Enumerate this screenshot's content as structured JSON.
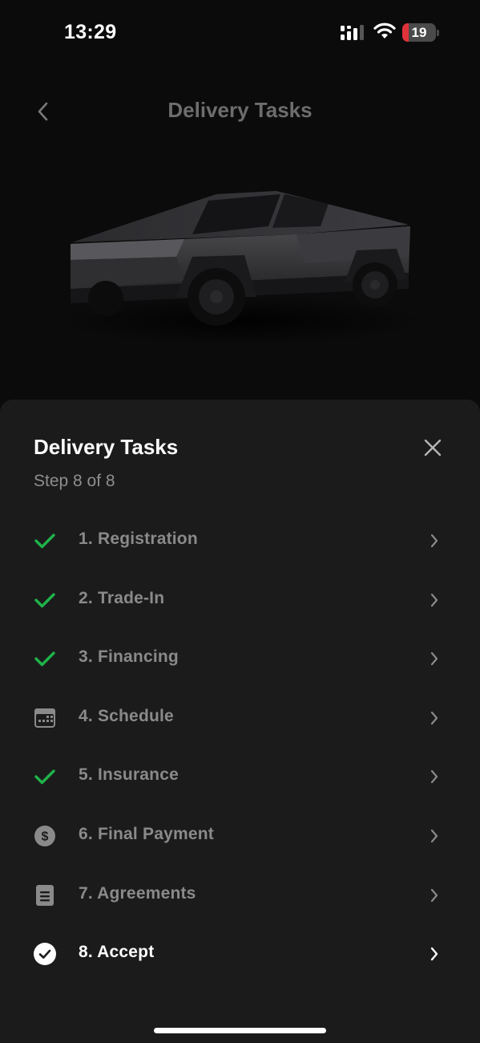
{
  "status_bar": {
    "time": "13:29",
    "battery_level": "19",
    "battery_color": "#e0323a",
    "icons": [
      "signal-icon",
      "wifi-icon",
      "battery-icon"
    ]
  },
  "header": {
    "title": "Delivery Tasks",
    "back_icon": "chevron-left-icon"
  },
  "vehicle": {
    "image": "cybertruck-image"
  },
  "sheet": {
    "title": "Delivery Tasks",
    "subtitle": "Step 8 of 8",
    "close_icon": "close-icon",
    "accent_color": "#1fb34a",
    "tasks": [
      {
        "label": "1. Registration",
        "icon": "check-icon",
        "status": "complete"
      },
      {
        "label": "2. Trade-In",
        "icon": "check-icon",
        "status": "complete"
      },
      {
        "label": "3. Financing",
        "icon": "check-icon",
        "status": "complete"
      },
      {
        "label": "4. Schedule",
        "icon": "calendar-icon",
        "status": "pending"
      },
      {
        "label": "5. Insurance",
        "icon": "check-icon",
        "status": "complete"
      },
      {
        "label": "6. Final Payment",
        "icon": "dollar-icon",
        "status": "pending"
      },
      {
        "label": "7. Agreements",
        "icon": "document-icon",
        "status": "pending"
      },
      {
        "label": "8. Accept",
        "icon": "check-circle-icon",
        "status": "current"
      }
    ]
  }
}
